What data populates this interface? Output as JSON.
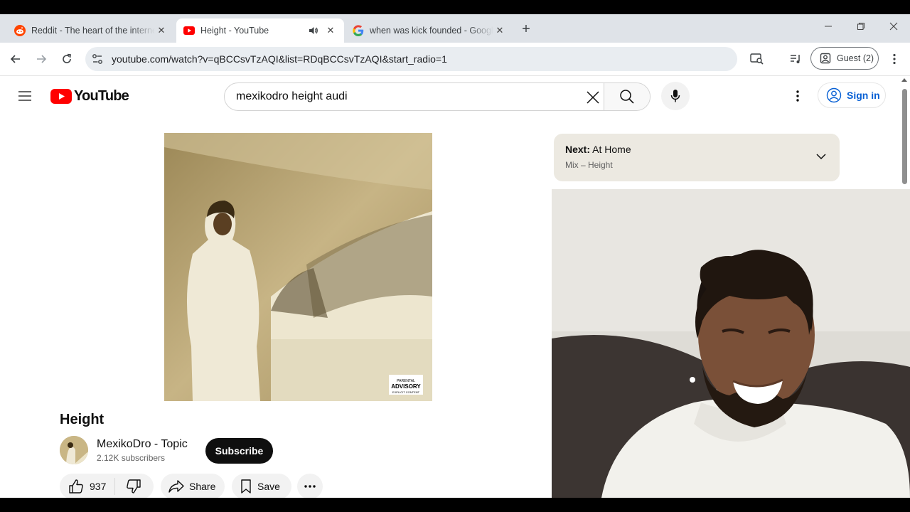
{
  "browser": {
    "tabs": [
      {
        "title": "Reddit - The heart of the internet",
        "icon": "reddit-icon",
        "active": false
      },
      {
        "title": "Height - YouTube",
        "icon": "youtube-icon",
        "active": true,
        "audio": true
      },
      {
        "title": "when was kick founded - Google Search",
        "icon": "google-icon",
        "active": false
      }
    ],
    "url": "youtube.com/watch?v=qBCCsvTzAQI&list=RDqBCCsvTzAQI&start_radio=1",
    "profile_label": "Guest (2)"
  },
  "youtube": {
    "logo_text": "YouTube",
    "search_value": "mexikodro height audi",
    "signin_label": "Sign in"
  },
  "video": {
    "title": "Height",
    "channel": "MexikoDro - Topic",
    "subscribers": "2.12K subscribers",
    "subscribe_label": "Subscribe",
    "likes": "937",
    "share_label": "Share",
    "save_label": "Save",
    "cover_sticker_line1": "PARENTAL",
    "cover_sticker_line2": "ADVISORY",
    "cover_sticker_line3": "EXPLICIT CONTENT"
  },
  "up_next": {
    "prefix": "Next:",
    "title": "At Home",
    "playlist": "Mix – Height"
  },
  "colors": {
    "youtube_red": "#ff0000",
    "signin_blue": "#065fd4",
    "tabstrip": "#dfe3e8",
    "next_card": "#ece9e1"
  }
}
